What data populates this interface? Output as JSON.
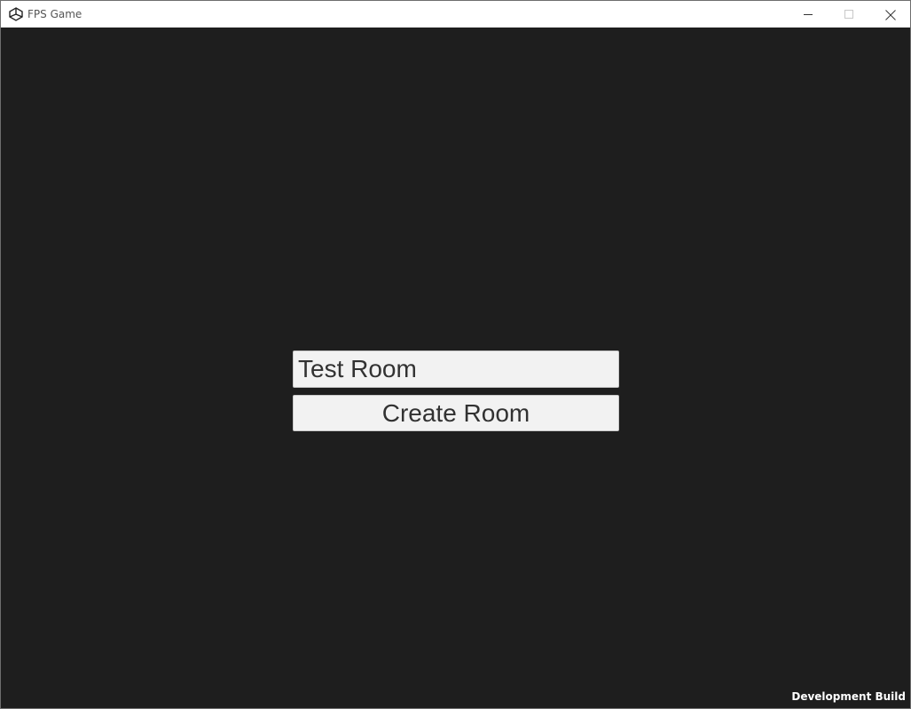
{
  "window": {
    "title": "FPS Game",
    "icon": "unity-icon"
  },
  "titlebar_controls": {
    "minimize_icon": "minimize-icon",
    "maximize_icon": "maximize-icon",
    "close_icon": "close-icon"
  },
  "room_form": {
    "room_name_value": "Test Room",
    "create_label": "Create Room"
  },
  "footer": {
    "build_label": "Development Build"
  },
  "colors": {
    "background": "#1e1e1e",
    "control_bg": "#f2f2f2",
    "control_text": "#323232"
  }
}
